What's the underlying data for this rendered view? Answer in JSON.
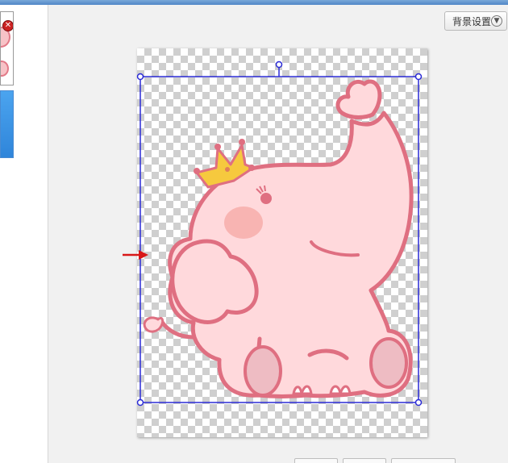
{
  "toolbar": {
    "background_settings_label": "背景设置"
  },
  "thumbnails": {
    "close_badge_symbol": "✕"
  },
  "colors": {
    "selection": "#2b2bd6",
    "arrow": "#d81818",
    "elephant_fill": "#ffd9dc",
    "elephant_outline": "#df6f81",
    "crown": "#f6c93e"
  }
}
